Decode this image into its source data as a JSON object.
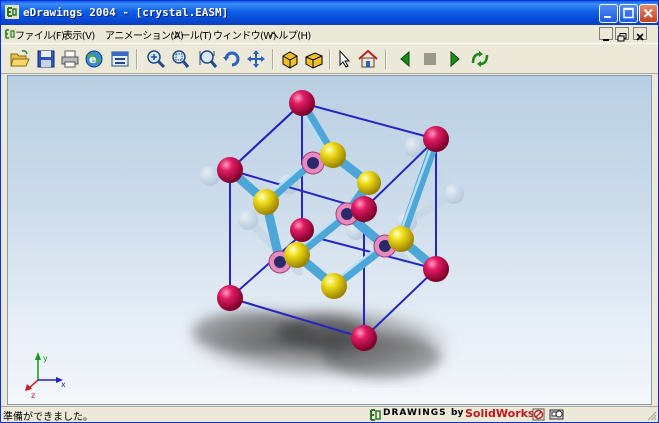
{
  "window": {
    "title": "eDrawings 2004 - [crystal.EASM]"
  },
  "menu": {
    "items": [
      {
        "label": "ファイル(F)"
      },
      {
        "label": "表示(V)"
      },
      {
        "label": "アニメーション(A)"
      },
      {
        "label": "ツール(T)"
      },
      {
        "label": "ウィンドウ(W)"
      },
      {
        "label": "ヘルプ(H)"
      }
    ]
  },
  "toolbar": {
    "icons": [
      "open-icon",
      "save-icon",
      "print-icon",
      "web-icon",
      "send-icon",
      "zoom-in-icon",
      "zoom-area-icon",
      "zoom-fit-icon",
      "rotate-icon",
      "pan-icon",
      "shaded-icon",
      "perspective-icon",
      "select-icon",
      "home-icon",
      "previous-icon",
      "stop-icon",
      "play-icon",
      "continuous-play-icon"
    ]
  },
  "status": {
    "text": "準備ができました。"
  },
  "brand": {
    "prefix": "DRAWINGS",
    "by": "by",
    "company": "SolidWorks"
  },
  "colors": {
    "magenta_atom": "#d0145a",
    "yellow_atom": "#e8d21a",
    "pink_ring": "#e08ac0",
    "bond": "#5db4e0",
    "frame": "#2929c8",
    "company": "#c4161c"
  }
}
